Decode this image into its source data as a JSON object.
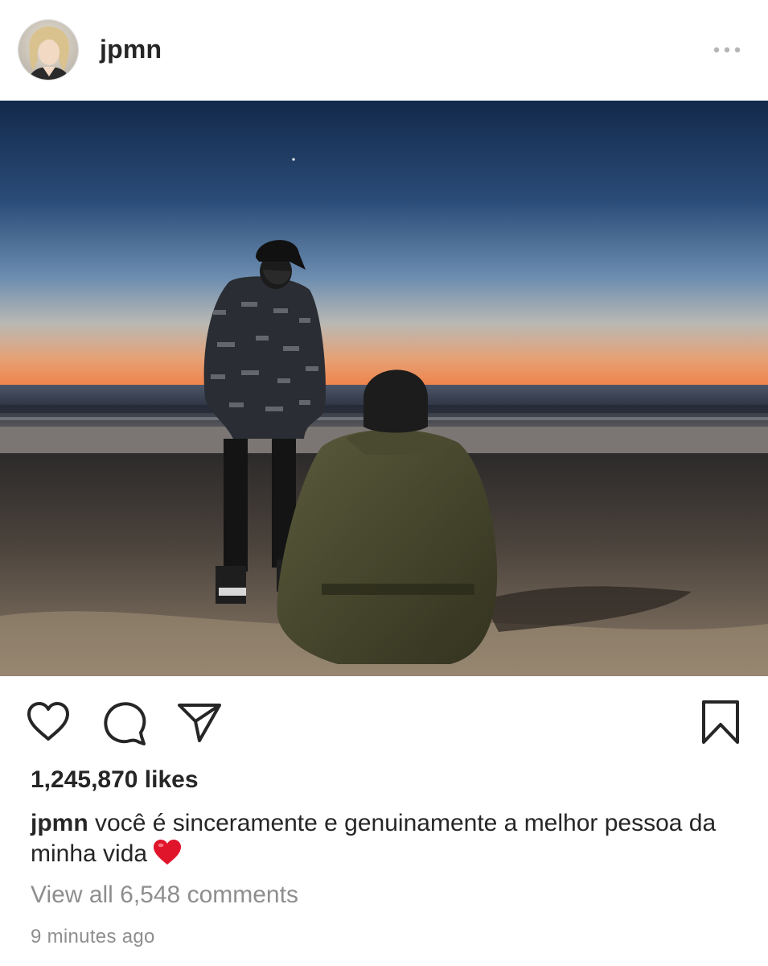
{
  "header": {
    "username": "jpmn",
    "avatar_icon": "profile-avatar",
    "more_icon": "more-dots-icon"
  },
  "photo": {
    "description_icon": "post-photo"
  },
  "actions": {
    "like_icon": "heart-icon",
    "comment_icon": "comment-icon",
    "share_icon": "paper-plane-icon",
    "save_icon": "bookmark-icon"
  },
  "post": {
    "likes": "1,245,870 likes",
    "caption_user": "jpmn",
    "caption_text": "você é sinceramente e genuinamente a melhor pessoa da minha vida",
    "caption_emoji": "heart-emoji",
    "view_comments": "View all 6,548 comments",
    "timestamp": "9 minutes ago"
  },
  "colors": {
    "text": "#262626",
    "secondary_text": "#8e8e8e",
    "heart_red": "#e0142b"
  }
}
